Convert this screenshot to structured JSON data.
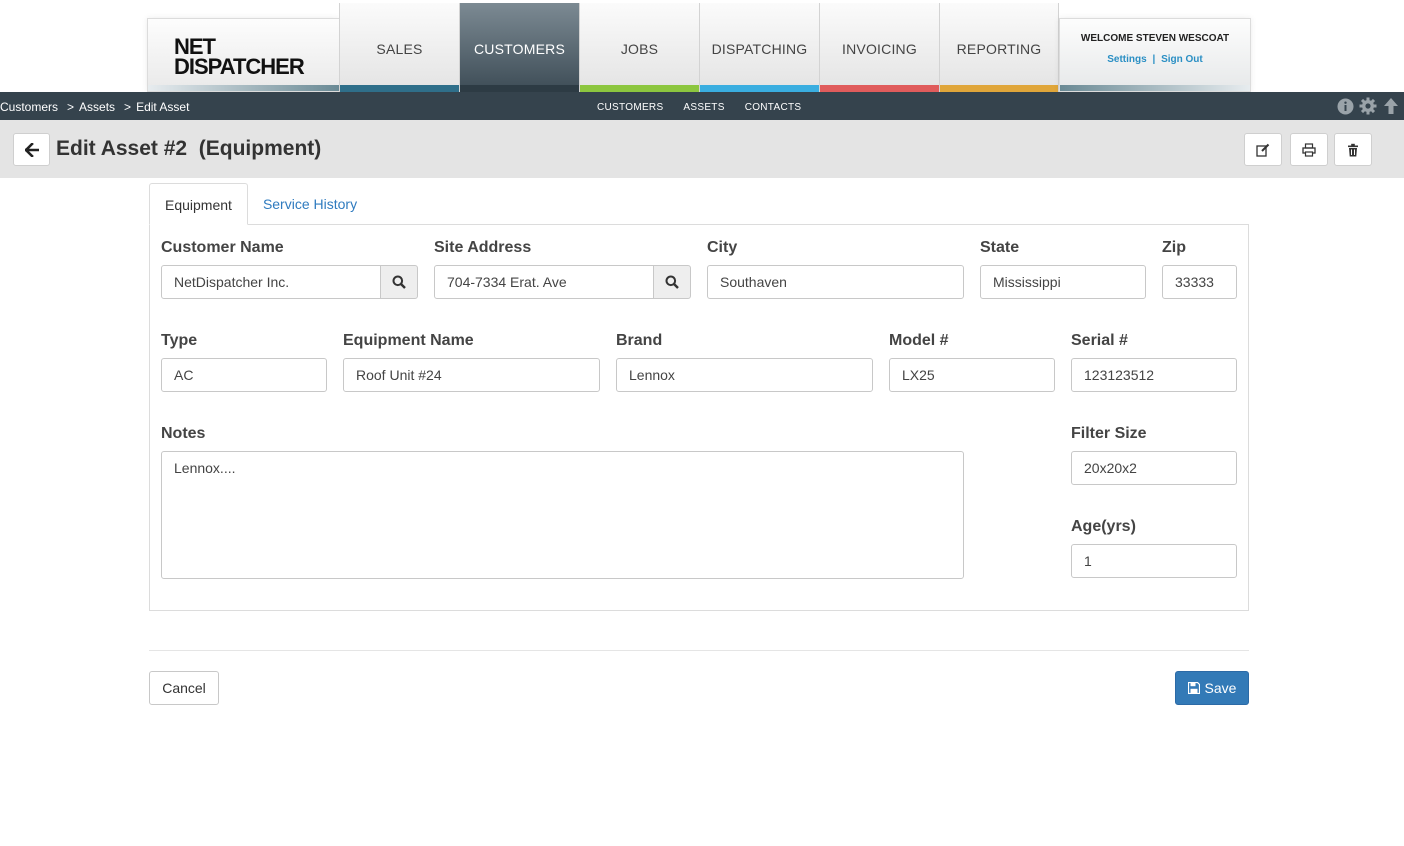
{
  "brand": {
    "logo_line1": "NET",
    "logo_line2": "DISPATCHER"
  },
  "nav": {
    "items": [
      {
        "label": "SALES",
        "color": "#2f6f8a",
        "active": false
      },
      {
        "label": "CUSTOMERS",
        "color": "#2d3b44",
        "active": true
      },
      {
        "label": "JOBS",
        "color": "#8cc63f",
        "active": false
      },
      {
        "label": "DISPATCHING",
        "color": "#3aaee0",
        "active": false
      },
      {
        "label": "INVOICING",
        "color": "#e05c5c",
        "active": false
      },
      {
        "label": "REPORTING",
        "color": "#e0a63a",
        "active": false
      }
    ]
  },
  "welcome": {
    "title": "WELCOME STEVEN WESCOAT",
    "settings": "Settings",
    "separator": "|",
    "signout": "Sign Out"
  },
  "breadcrumb": {
    "items": [
      "Customers",
      "Assets",
      "Edit Asset"
    ],
    "separator": ">"
  },
  "subnav": {
    "items": [
      "CUSTOMERS",
      "ASSETS",
      "CONTACTS"
    ]
  },
  "subicons": [
    "info-icon",
    "gear-icon",
    "arrow-up-icon"
  ],
  "title": {
    "text": "Edit Asset #2  (Equipment)"
  },
  "toolbar": {
    "buttons": [
      "edit-icon",
      "print-icon",
      "trash-icon"
    ]
  },
  "tabs": {
    "equipment": "Equipment",
    "service_history": "Service History"
  },
  "form": {
    "customer_name": {
      "label": "Customer Name",
      "value": "NetDispatcher Inc."
    },
    "site_address": {
      "label": "Site Address",
      "value": "704-7334 Erat. Ave"
    },
    "city": {
      "label": "City",
      "value": "Southaven"
    },
    "state": {
      "label": "State",
      "value": "Mississippi"
    },
    "zip": {
      "label": "Zip",
      "value": "33333"
    },
    "type": {
      "label": "Type",
      "value": "AC"
    },
    "equipment_name": {
      "label": "Equipment Name",
      "value": "Roof Unit #24"
    },
    "brand": {
      "label": "Brand",
      "value": "Lennox"
    },
    "model": {
      "label": "Model #",
      "value": "LX25"
    },
    "serial": {
      "label": "Serial #",
      "value": "123123512"
    },
    "notes": {
      "label": "Notes",
      "value": "Lennox...."
    },
    "filter_size": {
      "label": "Filter Size",
      "value": "20x20x2"
    },
    "age": {
      "label": "Age(yrs)",
      "value": "1"
    }
  },
  "footer": {
    "cancel": "Cancel",
    "save": "Save"
  }
}
